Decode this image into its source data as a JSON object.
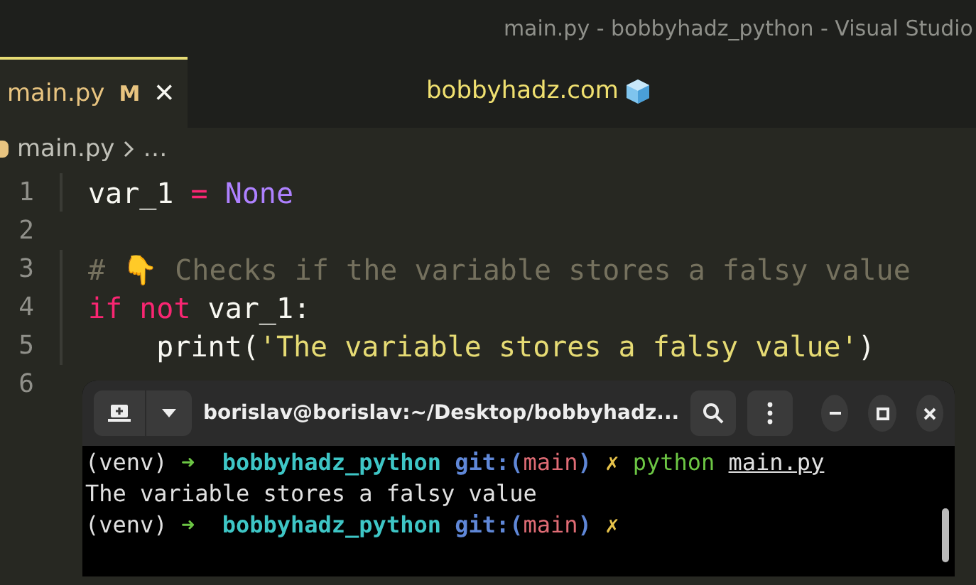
{
  "window": {
    "title": "main.py - bobbyhadz_python - Visual Studio"
  },
  "tabs": [
    {
      "label": "main.py",
      "badge": "M",
      "close": "×",
      "selected": true
    }
  ],
  "banner": "bobbyhadz.com",
  "breadcrumbs": [
    "main.py",
    "…"
  ],
  "editor": {
    "lines": [
      {
        "number": "1",
        "tokens": [
          {
            "text": "var_1 ",
            "kind": "plain"
          },
          {
            "text": "=",
            "kind": "operator"
          },
          {
            "text": " None",
            "kind": "constant"
          }
        ]
      },
      {
        "number": "2"
      },
      {
        "number": "3",
        "tokens": [
          {
            "text": "# 👇 Checks if the variable stores a falsy value",
            "kind": "comment"
          }
        ]
      },
      {
        "number": "4",
        "tokens": [
          {
            "text": "if not",
            "kind": "keyword"
          },
          {
            "text": " var_1:",
            "kind": "plain"
          }
        ]
      },
      {
        "number": "5",
        "tokens": [
          {
            "text": "    print(",
            "kind": "plain"
          },
          {
            "text": "'The variable stores a falsy value'",
            "kind": "string"
          },
          {
            "text": ")",
            "kind": "plain"
          }
        ]
      },
      {
        "number": "6"
      }
    ]
  },
  "terminal": {
    "title": "borislav@borislav:~/Desktop/bobbyhadz...",
    "lines": [
      [
        {
          "text": "(venv) ",
          "kind": "plain"
        },
        {
          "text": "➜",
          "kind": "arrow"
        },
        {
          "text": "  bobbyhadz_python",
          "kind": "dir"
        },
        {
          "text": " git:(",
          "kind": "git"
        },
        {
          "text": "main",
          "kind": "branch"
        },
        {
          "text": ")",
          "kind": "git"
        },
        {
          "text": " ✗",
          "kind": "dirty"
        },
        {
          "text": " python ",
          "kind": "command"
        },
        {
          "text": "main.py",
          "kind": "argument"
        }
      ],
      [
        {
          "text": "The variable stores a falsy value",
          "kind": "plain"
        }
      ],
      [
        {
          "text": "(venv) ",
          "kind": "plain"
        },
        {
          "text": "➜",
          "kind": "arrow"
        },
        {
          "text": "  bobbyhadz_python",
          "kind": "dir"
        },
        {
          "text": " git:(",
          "kind": "git"
        },
        {
          "text": "main",
          "kind": "branch"
        },
        {
          "text": ")",
          "kind": "git"
        },
        {
          "text": " ✗",
          "kind": "dirty"
        }
      ]
    ]
  }
}
